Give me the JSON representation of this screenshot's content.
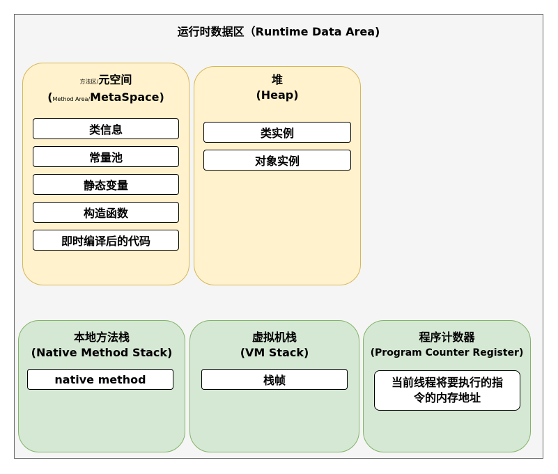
{
  "title": "运行时数据区（Runtime Data Area)",
  "method_area": {
    "title_prefix_small": "方法区/",
    "title_main": "元空间",
    "subtitle_open": "(",
    "subtitle_small": "Method Area/",
    "subtitle_main": "MetaSpace)",
    "items": [
      "类信息",
      "常量池",
      "静态变量",
      "构造函数",
      "即时编译后的代码"
    ]
  },
  "heap": {
    "title": "堆",
    "subtitle": "(Heap)",
    "items": [
      "类实例",
      "对象实例"
    ]
  },
  "native_stack": {
    "title": "本地方法栈",
    "subtitle": "(Native Method Stack)",
    "items": [
      "native method"
    ]
  },
  "vm_stack": {
    "title": "虚拟机栈",
    "subtitle": "(VM Stack)",
    "items": [
      "栈帧"
    ]
  },
  "pc_register": {
    "title": "程序计数器",
    "subtitle": "(Program Counter Register)",
    "item_line1": "当前线程将要执行的指",
    "item_line2": "令的内存地址"
  },
  "colors": {
    "yellow_fill": "#fff2cc",
    "yellow_stroke": "#d6b656",
    "green_fill": "#d5e8d4",
    "green_stroke": "#82b366",
    "background": "#f5f5f5"
  }
}
